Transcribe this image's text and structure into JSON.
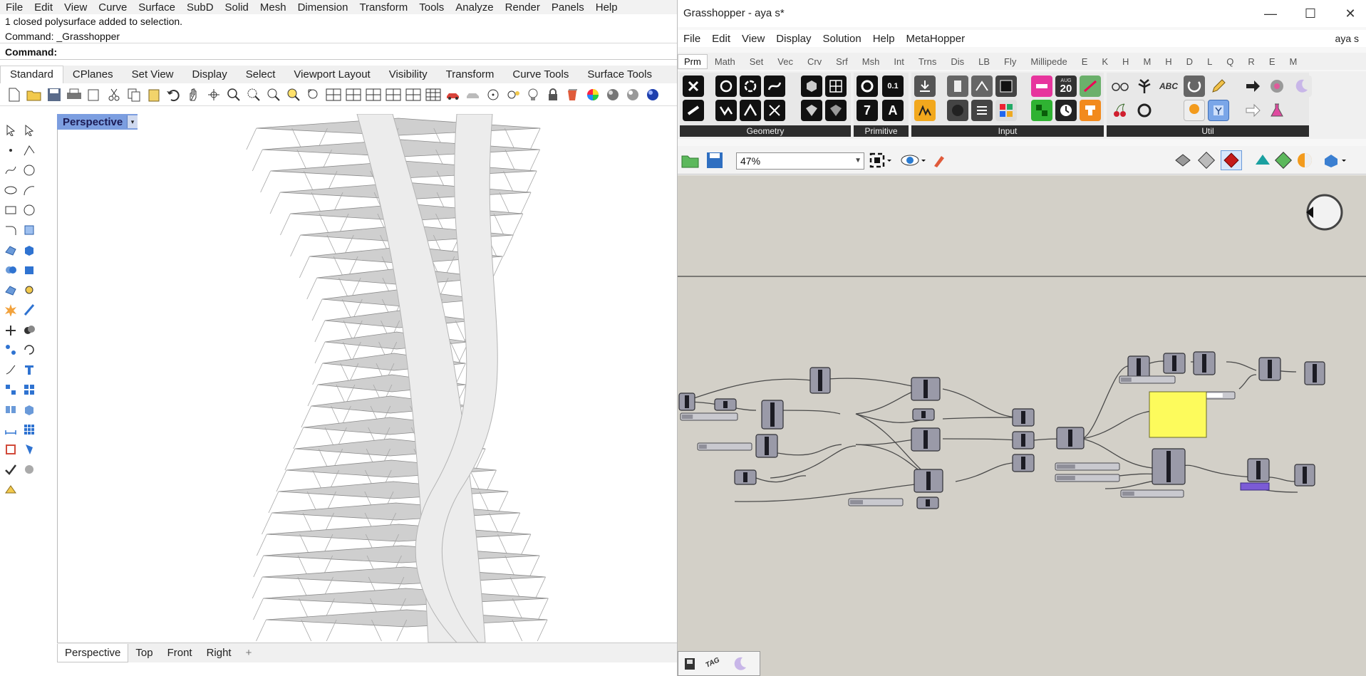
{
  "rhino": {
    "menu": [
      "File",
      "Edit",
      "View",
      "Curve",
      "Surface",
      "SubD",
      "Solid",
      "Mesh",
      "Dimension",
      "Transform",
      "Tools",
      "Analyze",
      "Render",
      "Panels",
      "Help"
    ],
    "history": [
      "1 closed polysurface added to selection.",
      "Command: _Grasshopper"
    ],
    "command_label": "Command:",
    "tabs": [
      "Standard",
      "CPlanes",
      "Set View",
      "Display",
      "Select",
      "Viewport Layout",
      "Visibility",
      "Transform",
      "Curve Tools",
      "Surface Tools"
    ],
    "active_tab": "Standard",
    "viewport_title": "Perspective",
    "viewport_tabs": [
      "Perspective",
      "Top",
      "Front",
      "Right"
    ],
    "viewport_tab_add": "+",
    "active_viewport_tab": "Perspective"
  },
  "grasshopper": {
    "title": "Grasshopper - aya s*",
    "window_controls": {
      "minimize": "—",
      "maximize": "☐",
      "close": "✕"
    },
    "menu": [
      "File",
      "Edit",
      "View",
      "Display",
      "Solution",
      "Help",
      "MetaHopper"
    ],
    "user": "aya s",
    "tabs": [
      "Prm",
      "Math",
      "Set",
      "Vec",
      "Crv",
      "Srf",
      "Msh",
      "Int",
      "Trns",
      "Dis",
      "LB",
      "Fly",
      "Millipede",
      "E",
      "K",
      "H",
      "M",
      "H",
      "D",
      "L",
      "Q",
      "R",
      "E",
      "M"
    ],
    "active_tab": "Prm",
    "ribbon_groups": [
      "Geometry",
      "Primitive",
      "Input",
      "Util"
    ],
    "zoom": "47%",
    "calendar_month": "AUG",
    "calendar_day": "20",
    "number_slider_text": "0.1",
    "text_icon": "ABC",
    "primitive_letter": "A",
    "primitive_number": "7",
    "status_icon_text": "TAG"
  }
}
